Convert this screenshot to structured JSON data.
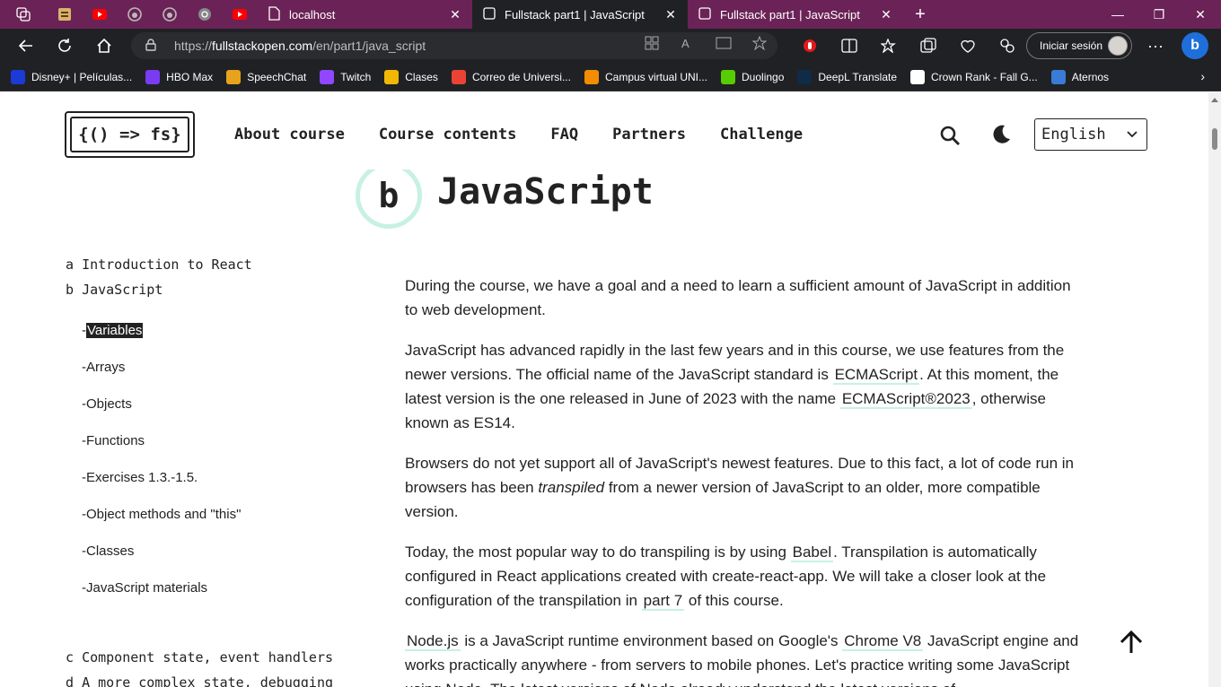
{
  "tabs": [
    {
      "title": "localhost",
      "active": false
    },
    {
      "title": "Fullstack part1 | JavaScript",
      "active": true
    },
    {
      "title": "Fullstack part1 | JavaScript",
      "active": false
    }
  ],
  "address": {
    "url_prefix": "https://",
    "url_domain": "fullstackopen.com",
    "url_path": "/en/part1/java_script",
    "signin_label": "Iniciar sesión"
  },
  "bookmarks": [
    {
      "label": "Disney+ | Películas...",
      "icon": "disney-icon",
      "color": "#1a3bd6"
    },
    {
      "label": "HBO Max",
      "icon": "hbo-icon",
      "color": "#7a3cf2"
    },
    {
      "label": "SpeechChat",
      "icon": "speechchat-icon",
      "color": "#e8a21c"
    },
    {
      "label": "Twitch",
      "icon": "twitch-icon",
      "color": "#9146ff"
    },
    {
      "label": "Clases",
      "icon": "classroom-icon",
      "color": "#f2b705"
    },
    {
      "label": "Correo de Universi...",
      "icon": "gmail-icon",
      "color": "#ea4335"
    },
    {
      "label": "Campus virtual UNI...",
      "icon": "campus-icon",
      "color": "#f28c00"
    },
    {
      "label": "Duolingo",
      "icon": "duolingo-icon",
      "color": "#58cc02"
    },
    {
      "label": "DeepL Translate",
      "icon": "deepl-icon",
      "color": "#0f2b46"
    },
    {
      "label": "Crown Rank - Fall G...",
      "icon": "crownrank-icon",
      "color": "#ffffff"
    },
    {
      "label": "Aternos",
      "icon": "aternos-icon",
      "color": "#3a7bd5"
    }
  ],
  "site": {
    "logo_text": "{() => fs}",
    "nav": [
      "About course",
      "Course contents",
      "FAQ",
      "Partners",
      "Challenge"
    ],
    "language": "English"
  },
  "page": {
    "part_letter": "b",
    "title": "JavaScript"
  },
  "sidebar": {
    "parts_top": [
      {
        "letter": "a",
        "label": "Introduction to React"
      },
      {
        "letter": "b",
        "label": "JavaScript"
      }
    ],
    "subsections": [
      "Variables",
      "Arrays",
      "Objects",
      "Functions",
      "Exercises 1.3.-1.5.",
      "Object methods and \"this\"",
      "Classes",
      "JavaScript materials"
    ],
    "parts_bottom": [
      {
        "letter": "c",
        "label": "Component state, event handlers"
      },
      {
        "letter": "d",
        "label": "A more complex state, debugging"
      }
    ]
  },
  "content": {
    "p1": "During the course, we have a goal and a need to learn a sufficient amount of JavaScript in addition to web development.",
    "p2_a": "JavaScript has advanced rapidly in the last few years and in this course, we use features from the newer versions. The official name of the JavaScript standard is ",
    "p2_link1": "ECMAScript",
    "p2_b": ". At this moment, the latest version is the one released in June of 2023 with the name ",
    "p2_link2": "ECMAScript®2023",
    "p2_c": ", otherwise known as ES14.",
    "p3_a": "Browsers do not yet support all of JavaScript's newest features. Due to this fact, a lot of code run in browsers has been ",
    "p3_em": "transpiled",
    "p3_b": " from a newer version of JavaScript to an older, more compatible version.",
    "p4_a": "Today, the most popular way to do transpiling is by using ",
    "p4_link1": "Babel",
    "p4_b": ". Transpilation is automatically configured in React applications created with create-react-app. We will take a closer look at the configuration of the transpilation in ",
    "p4_link2": "part 7",
    "p4_c": " of this course.",
    "p5_link1": "Node.js",
    "p5_a": " is a JavaScript runtime environment based on Google's ",
    "p5_link2": "Chrome V8",
    "p5_b": " JavaScript engine and works practically anywhere - from servers to mobile phones. Let's practice writing some JavaScript using Node. The latest versions of Node already understand the latest versions of"
  }
}
